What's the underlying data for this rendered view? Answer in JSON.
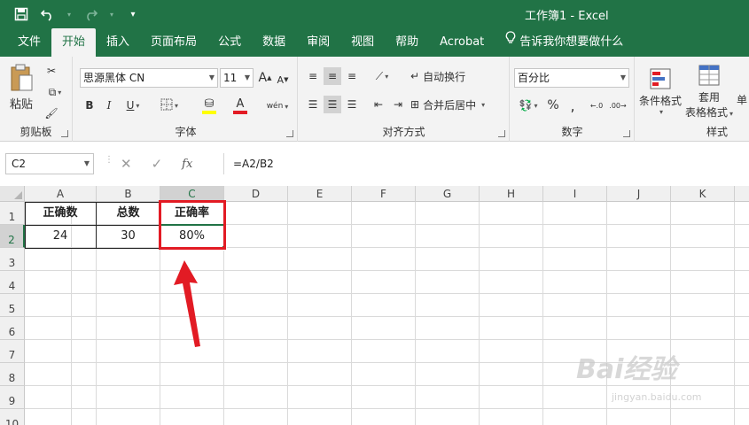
{
  "window": {
    "title": "工作簿1  -  Excel",
    "qat": {
      "save_icon": "save-icon",
      "undo_icon": "undo-icon",
      "redo_icon": "redo-icon",
      "customize_icon": "customize-icon"
    }
  },
  "tabs": [
    {
      "label": "文件"
    },
    {
      "label": "开始"
    },
    {
      "label": "插入"
    },
    {
      "label": "页面布局"
    },
    {
      "label": "公式"
    },
    {
      "label": "数据"
    },
    {
      "label": "审阅"
    },
    {
      "label": "视图"
    },
    {
      "label": "帮助"
    },
    {
      "label": "Acrobat"
    },
    {
      "label": "告诉我你想要做什么"
    }
  ],
  "ribbon": {
    "clipboard": {
      "paste_label": "粘贴",
      "group_label": "剪贴板"
    },
    "font": {
      "font_name": "思源黑体 CN",
      "font_size": "11",
      "bold": "B",
      "italic": "I",
      "underline": "U",
      "grow": "A",
      "shrink": "A",
      "font_color_letter": "A",
      "phonetic": "wén",
      "group_label": "字体"
    },
    "alignment": {
      "wrap_text": "自动换行",
      "merge_center": "合并后居中",
      "group_label": "对齐方式"
    },
    "number": {
      "format": "百分比",
      "percent": "%",
      "group_label": "数字"
    },
    "styles": {
      "conditional_format": "条件格式",
      "table_format_line1": "套用",
      "table_format_line2": "表格格式",
      "cell_styles": "单",
      "group_label": "样式"
    }
  },
  "formula_bar": {
    "name_box": "C2",
    "fx": "fx",
    "formula": "=A2/B2"
  },
  "sheet": {
    "columns": [
      "A",
      "B",
      "C",
      "D",
      "E",
      "F",
      "G",
      "H",
      "I",
      "J",
      "K"
    ],
    "rows": [
      "1",
      "2",
      "3",
      "4",
      "5",
      "6",
      "7",
      "8",
      "9",
      "10"
    ],
    "selected_cell": "C2",
    "cells": {
      "A1": "正确数",
      "B1": "总数",
      "C1": "正确率",
      "A2": "24",
      "B2": "30",
      "C2": "80%"
    }
  },
  "colors": {
    "excel_green": "#217346",
    "highlight_red": "#e21b24"
  },
  "watermark": {
    "text": "Bai经验",
    "sub": "jingyan.baidu.com"
  }
}
